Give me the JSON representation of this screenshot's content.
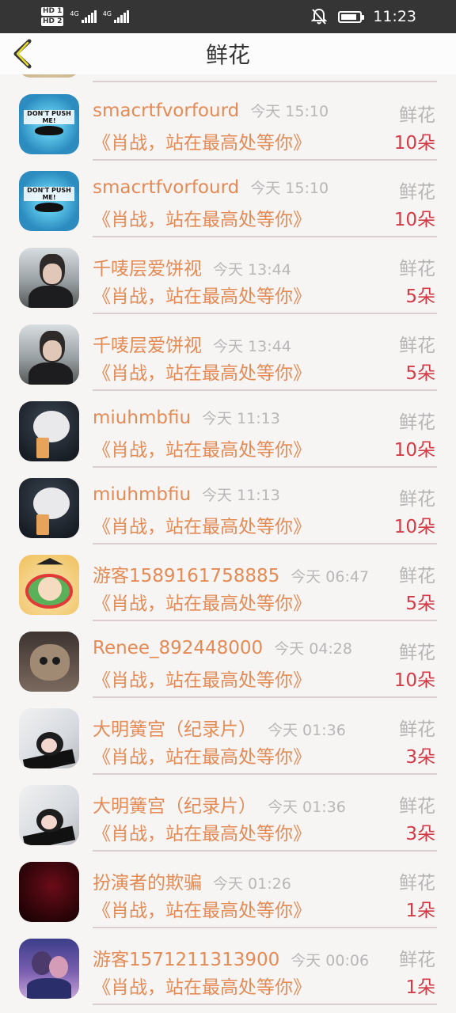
{
  "status_bar": {
    "hd1": "HD 1",
    "hd2": "HD 2",
    "sig1_label": "4G",
    "sig2_label": "4G",
    "time": "11:23"
  },
  "header": {
    "title": "鲜花",
    "back_icon": "chevron-left-icon"
  },
  "list": [
    {
      "avatar": "mustache",
      "name": "smacrtfvorfourd",
      "time": "今天 15:10",
      "kind": "鲜花",
      "message": "《肖战，站在最高处等你》",
      "count": "10朵"
    },
    {
      "avatar": "mustache",
      "name": "smacrtfvorfourd",
      "time": "今天 15:10",
      "kind": "鲜花",
      "message": "《肖战，站在最高处等你》",
      "count": "10朵"
    },
    {
      "avatar": "person",
      "name": "千唛层爱饼视",
      "time": "今天 13:44",
      "kind": "鲜花",
      "message": "《肖战，站在最高处等你》",
      "count": "5朵"
    },
    {
      "avatar": "person",
      "name": "千唛层爱饼视",
      "time": "今天 13:44",
      "kind": "鲜花",
      "message": "《肖战，站在最高处等你》",
      "count": "5朵"
    },
    {
      "avatar": "cat",
      "name": "miuhmbfiu",
      "time": "今天 11:13",
      "kind": "鲜花",
      "message": "《肖战，站在最高处等你》",
      "count": "10朵"
    },
    {
      "avatar": "cat",
      "name": "miuhmbfiu",
      "time": "今天 11:13",
      "kind": "鲜花",
      "message": "《肖战，站在最高处等你》",
      "count": "10朵"
    },
    {
      "avatar": "cartoon",
      "name": "游客1589161758885",
      "time": "今天 06:47",
      "kind": "鲜花",
      "message": "《肖战，站在最高处等你》",
      "count": "5朵"
    },
    {
      "avatar": "kitten",
      "name": "Renee_892448000",
      "time": "今天 04:28",
      "kind": "鲜花",
      "message": "《肖战，站在最高处等你》",
      "count": "10朵"
    },
    {
      "avatar": "girl",
      "name": "大明簧宫（纪录片）",
      "time": "今天 01:36",
      "kind": "鲜花",
      "message": "《肖战，站在最高处等你》",
      "count": "3朵"
    },
    {
      "avatar": "girl",
      "name": "大明簧宫（纪录片）",
      "time": "今天 01:36",
      "kind": "鲜花",
      "message": "《肖战，站在最高处等你》",
      "count": "3朵"
    },
    {
      "avatar": "dark",
      "name": "扮演者的欺骗",
      "time": "今天 01:26",
      "kind": "鲜花",
      "message": "《肖战，站在最高处等你》",
      "count": "1朵"
    },
    {
      "avatar": "anime",
      "name": "游客1571211313900",
      "time": "今天 00:06",
      "kind": "鲜花",
      "message": "《肖战，站在最高处等你》",
      "count": "1朵"
    }
  ]
}
